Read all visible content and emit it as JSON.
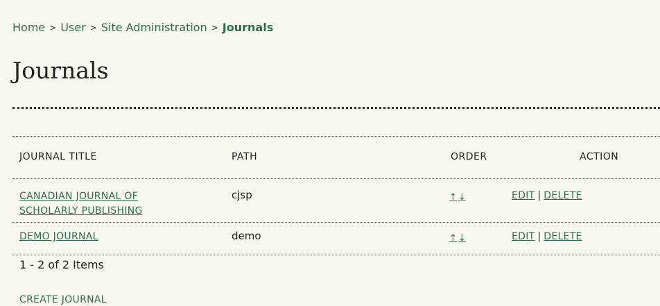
{
  "breadcrumb": {
    "home": "Home",
    "user": "User",
    "site_admin": "Site Administration",
    "current": "Journals",
    "separator": ">"
  },
  "page_title": "Journals",
  "table": {
    "headers": {
      "title": "JOURNAL TITLE",
      "path": "PATH",
      "order": "ORDER",
      "action": "ACTION"
    },
    "rows": [
      {
        "title_line1": "CANADIAN JOURNAL OF",
        "title_line2": "SCHOLARLY PUBLISHING",
        "path": "cjsp",
        "order_up": "↑",
        "order_down": "↓",
        "edit": "EDIT",
        "delete": "DELETE"
      },
      {
        "title_line1": "DEMO JOURNAL",
        "title_line2": "",
        "path": "demo",
        "order_up": "↑",
        "order_down": "↓",
        "edit": "EDIT",
        "delete": "DELETE"
      }
    ],
    "action_separator": "|"
  },
  "pagination": {
    "summary": "1 - 2 of 2 Items"
  },
  "actions": {
    "create": "CREATE JOURNAL"
  },
  "colors": {
    "link": "#2e6b50",
    "background": "#f8f8f0",
    "text": "#222222"
  }
}
